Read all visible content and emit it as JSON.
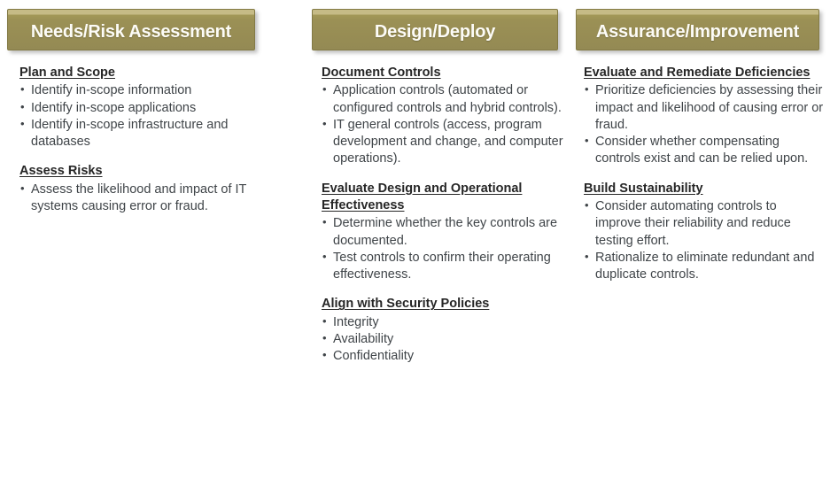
{
  "diagram": {
    "type": "three-phase-process-columns",
    "accent_color": "#948a54",
    "accent_bevel_color": "#c6bb86",
    "banner_text_color": "#fdfcf7",
    "heading_color": "#262626",
    "body_text_color": "#3f4448",
    "background_color": "#ffffff"
  },
  "columns": [
    {
      "banner": "Needs/Risk Assessment",
      "sections": [
        {
          "heading": "Plan and Scope",
          "bullets": [
            "Identify in-scope information",
            "Identify in-scope applications",
            "Identify in-scope infrastructure and databases"
          ]
        },
        {
          "heading": "Assess Risks",
          "bullets": [
            "Assess the likelihood and impact of IT systems causing error or fraud."
          ]
        }
      ]
    },
    {
      "banner": "Design/Deploy",
      "sections": [
        {
          "heading": "Document Controls",
          "bullets": [
            "Application controls (automated or configured controls and hybrid controls).",
            "IT general controls (access, program development and change, and computer operations)."
          ]
        },
        {
          "heading": "Evaluate Design and Operational Effectiveness",
          "bullets": [
            "Determine whether the key controls are documented.",
            "Test controls to confirm their operating effectiveness."
          ]
        },
        {
          "heading": "Align with Security Policies",
          "bullets": [
            "Integrity",
            "Availability",
            "Confidentiality"
          ]
        }
      ]
    },
    {
      "banner": "Assurance/Improvement",
      "sections": [
        {
          "heading": "Evaluate and Remediate Deficiencies",
          "bullets": [
            "Prioritize deficiencies by assessing their impact and likelihood of causing error or fraud.",
            "Consider whether compensating controls exist and can be relied upon."
          ]
        },
        {
          "heading": "Build Sustainability",
          "bullets": [
            "Consider automating controls to improve their reliability and reduce testing effort.",
            "Rationalize to eliminate redundant and duplicate controls."
          ]
        }
      ]
    }
  ]
}
